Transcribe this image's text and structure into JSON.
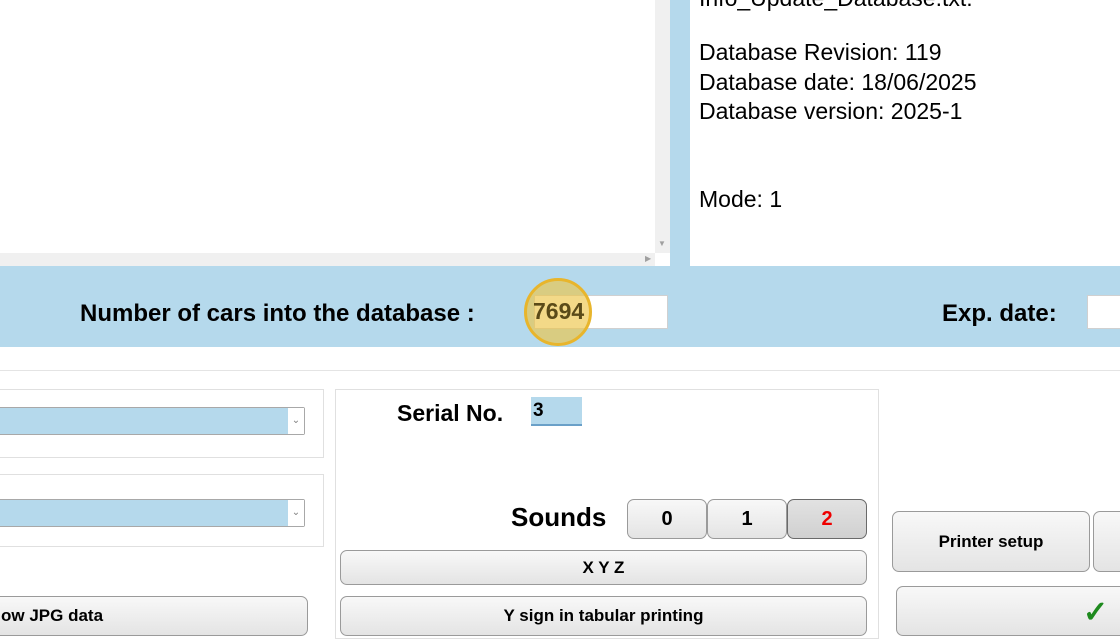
{
  "info": {
    "filename_partial": "Info_Update_Database.txt:",
    "revision": "Database Revision: 119",
    "date": "Database date: 18/06/2025",
    "version": "Database version: 2025-1",
    "mode": "Mode: 1"
  },
  "count": {
    "label": "Number of cars into the database :",
    "value": "7694"
  },
  "exp": {
    "label": "Exp. date:",
    "value": ""
  },
  "serial": {
    "label": "Serial No.",
    "value": "3"
  },
  "sounds": {
    "label": "Sounds",
    "options": [
      "0",
      "1",
      "2"
    ],
    "selected": "2"
  },
  "buttons": {
    "xyz": "X Y Z",
    "y_sign": "Y sign in tabular printing",
    "show_jpg": "ow JPG data",
    "printer_setup": "Printer setup"
  },
  "icons": {
    "ok": "checkmark-icon"
  },
  "colors": {
    "panel_blue": "#b5d9ec",
    "highlight": "#ecc448",
    "selected_red": "#ee0000",
    "check_green": "#1e8a1e"
  }
}
